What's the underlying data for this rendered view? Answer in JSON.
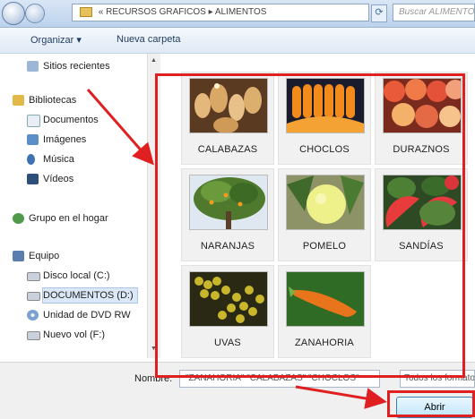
{
  "address_bar": {
    "path": "« RECURSOS GRAFICOS ▸ ALIMENTOS",
    "search_placeholder": "Buscar ALIMENTOS"
  },
  "toolbar": {
    "organize": "Organizar ▾",
    "new_folder": "Nueva carpeta"
  },
  "nav": {
    "recent": "Sitios recientes",
    "libraries": "Bibliotecas",
    "documents": "Documentos",
    "images": "Imágenes",
    "music": "Música",
    "videos": "Vídeos",
    "homegroup": "Grupo en el hogar",
    "computer": "Equipo",
    "disk_c": "Disco local (C:)",
    "documentos_d": "DOCUMENTOS (D:)",
    "dvd": "Unidad de DVD RW",
    "newvol": "Nuevo vol (F:)"
  },
  "files": [
    {
      "name": "CALABAZAS"
    },
    {
      "name": "CHOCLOS"
    },
    {
      "name": "DURAZNOS"
    },
    {
      "name": "NARANJAS"
    },
    {
      "name": "POMELO"
    },
    {
      "name": "SANDÍAS"
    },
    {
      "name": "UVAS"
    },
    {
      "name": "ZANAHORIA"
    }
  ],
  "bottom": {
    "name_label": "Nombre:",
    "name_value": "\"ZANAHORIA\" \"CALABAZAS\" \"CHOCLOS\"",
    "filter": "Todos los formatos",
    "open": "Abrir"
  },
  "colors": {
    "annotation": "#e02020",
    "accent": "#3c7fb1"
  }
}
